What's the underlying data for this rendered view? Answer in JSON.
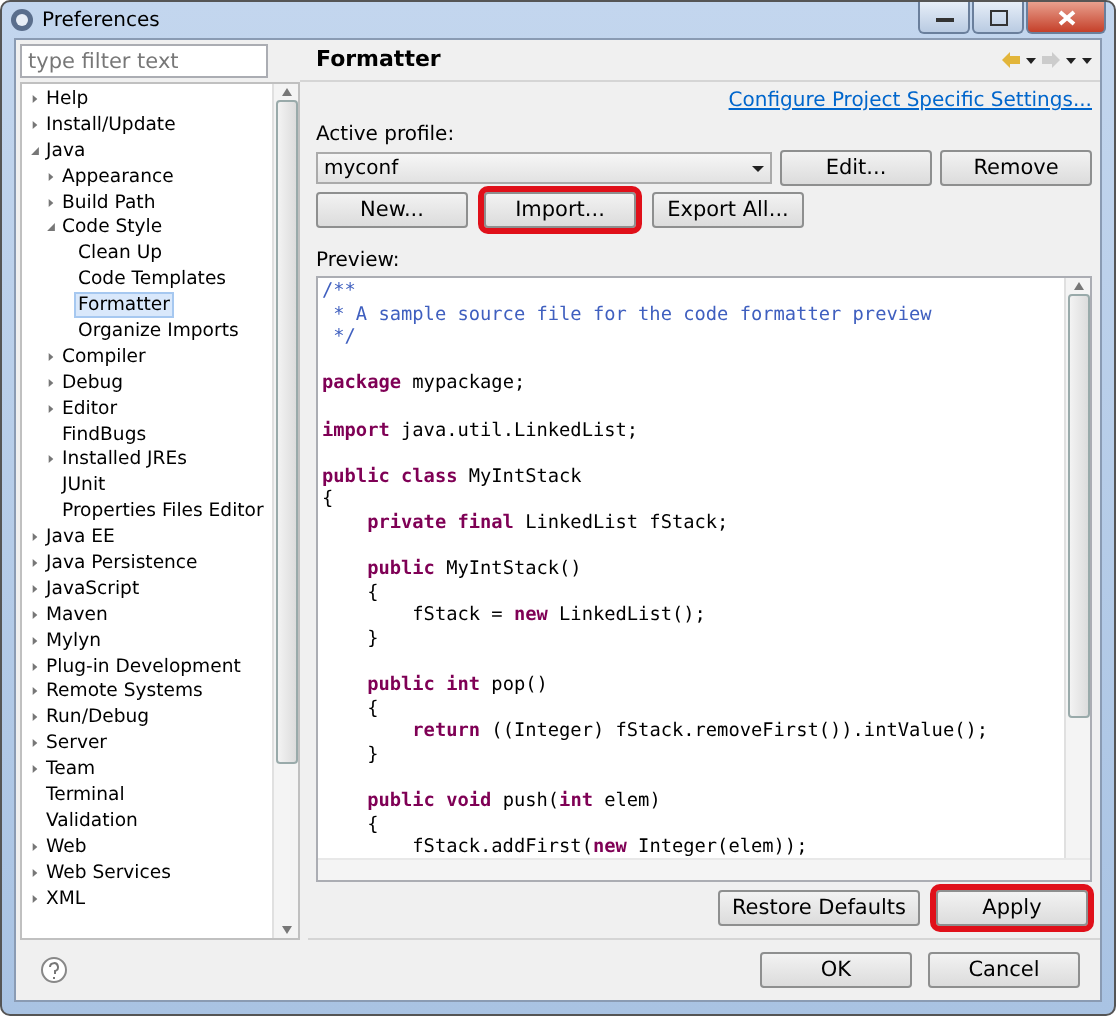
{
  "window": {
    "title": "Preferences"
  },
  "filter": {
    "placeholder": "type filter text"
  },
  "tree": [
    {
      "label": "Help",
      "expanded": false,
      "selected": false
    },
    {
      "label": "Install/Update",
      "expanded": false,
      "selected": false
    },
    {
      "label": "Java",
      "expanded": true,
      "selected": false,
      "children": [
        {
          "label": "Appearance",
          "expanded": false,
          "selected": false
        },
        {
          "label": "Build Path",
          "expanded": false,
          "selected": false
        },
        {
          "label": "Code Style",
          "expanded": true,
          "selected": false,
          "children": [
            {
              "label": "Clean Up",
              "selected": false
            },
            {
              "label": "Code Templates",
              "selected": false
            },
            {
              "label": "Formatter",
              "selected": true
            },
            {
              "label": "Organize Imports",
              "selected": false
            }
          ]
        },
        {
          "label": "Compiler",
          "expanded": false,
          "selected": false
        },
        {
          "label": "Debug",
          "expanded": false,
          "selected": false
        },
        {
          "label": "Editor",
          "expanded": false,
          "selected": false
        },
        {
          "label": "FindBugs",
          "selected": false
        },
        {
          "label": "Installed JREs",
          "expanded": false,
          "selected": false
        },
        {
          "label": "JUnit",
          "selected": false
        },
        {
          "label": "Properties Files Editor",
          "selected": false
        }
      ]
    },
    {
      "label": "Java EE",
      "expanded": false,
      "selected": false
    },
    {
      "label": "Java Persistence",
      "expanded": false,
      "selected": false
    },
    {
      "label": "JavaScript",
      "expanded": false,
      "selected": false
    },
    {
      "label": "Maven",
      "expanded": false,
      "selected": false
    },
    {
      "label": "Mylyn",
      "expanded": false,
      "selected": false
    },
    {
      "label": "Plug-in Development",
      "expanded": false,
      "selected": false
    },
    {
      "label": "Remote Systems",
      "expanded": false,
      "selected": false
    },
    {
      "label": "Run/Debug",
      "expanded": false,
      "selected": false
    },
    {
      "label": "Server",
      "expanded": false,
      "selected": false
    },
    {
      "label": "Team",
      "expanded": false,
      "selected": false
    },
    {
      "label": "Terminal",
      "selected": false
    },
    {
      "label": "Validation",
      "selected": false
    },
    {
      "label": "Web",
      "expanded": false,
      "selected": false
    },
    {
      "label": "Web Services",
      "expanded": false,
      "selected": false
    },
    {
      "label": "XML",
      "expanded": false,
      "selected": false
    }
  ],
  "page": {
    "title": "Formatter",
    "link": "Configure Project Specific Settings...",
    "profile_label": "Active profile:",
    "profile_value": "myconf",
    "profile_buttons": [
      {
        "label": "Edit...",
        "highlighted": false
      },
      {
        "label": "Remove",
        "highlighted": false
      }
    ],
    "buttons": [
      {
        "label": "New...",
        "highlighted": false
      },
      {
        "label": "Import...",
        "highlighted": true
      },
      {
        "label": "Export All...",
        "highlighted": false
      }
    ],
    "preview_label": "Preview:",
    "code": [
      {
        "tokens": [
          {
            "kind": "comment",
            "text": "/**"
          }
        ]
      },
      {
        "tokens": [
          {
            "kind": "comment",
            "text": " * A sample source file for the code formatter preview"
          }
        ]
      },
      {
        "tokens": [
          {
            "kind": "comment",
            "text": " */"
          }
        ]
      },
      {
        "kind": "blank"
      },
      {
        "tokens": [
          {
            "kind": "keyword",
            "text": "package"
          },
          {
            "kind": "plain",
            "text": " mypackage;"
          }
        ]
      },
      {
        "kind": "blank"
      },
      {
        "tokens": [
          {
            "kind": "keyword",
            "text": "import"
          },
          {
            "kind": "plain",
            "text": " java.util.LinkedList;"
          }
        ]
      },
      {
        "kind": "blank"
      },
      {
        "tokens": [
          {
            "kind": "keyword",
            "text": "public class"
          },
          {
            "kind": "plain",
            "text": " MyIntStack"
          }
        ]
      },
      {
        "tokens": [
          {
            "kind": "plain",
            "text": "{"
          }
        ]
      },
      {
        "tokens": [
          {
            "kind": "keyword",
            "text": "    private final"
          },
          {
            "kind": "plain",
            "text": " LinkedList fStack;"
          }
        ]
      },
      {
        "kind": "blank"
      },
      {
        "tokens": [
          {
            "kind": "keyword",
            "text": "    public"
          },
          {
            "kind": "plain",
            "text": " MyIntStack()"
          }
        ]
      },
      {
        "tokens": [
          {
            "kind": "plain",
            "text": "    {"
          }
        ]
      },
      {
        "tokens": [
          {
            "kind": "plain",
            "text": "        fStack = "
          },
          {
            "kind": "keyword",
            "text": "new"
          },
          {
            "kind": "plain",
            "text": " LinkedList();"
          }
        ]
      },
      {
        "tokens": [
          {
            "kind": "plain",
            "text": "    }"
          }
        ]
      },
      {
        "kind": "blank"
      },
      {
        "tokens": [
          {
            "kind": "keyword",
            "text": "    public int"
          },
          {
            "kind": "plain",
            "text": " pop()"
          }
        ]
      },
      {
        "tokens": [
          {
            "kind": "plain",
            "text": "    {"
          }
        ]
      },
      {
        "tokens": [
          {
            "kind": "keyword",
            "text": "        return"
          },
          {
            "kind": "plain",
            "text": " ((Integer) fStack.removeFirst()).intValue();"
          }
        ]
      },
      {
        "tokens": [
          {
            "kind": "plain",
            "text": "    }"
          }
        ]
      },
      {
        "kind": "blank"
      },
      {
        "tokens": [
          {
            "kind": "keyword",
            "text": "    public void"
          },
          {
            "kind": "plain",
            "text": " push("
          },
          {
            "kind": "keyword",
            "text": "int"
          },
          {
            "kind": "plain",
            "text": " elem)"
          }
        ]
      },
      {
        "tokens": [
          {
            "kind": "plain",
            "text": "    {"
          }
        ]
      },
      {
        "tokens": [
          {
            "kind": "plain",
            "text": "        fStack.addFirst("
          },
          {
            "kind": "keyword",
            "text": "new"
          },
          {
            "kind": "plain",
            "text": " Integer(elem));"
          }
        ]
      }
    ],
    "bottom_buttons": [
      {
        "label": "Restore Defaults",
        "highlighted": false
      },
      {
        "label": "Apply",
        "highlighted": true
      }
    ]
  },
  "dialog_buttons": [
    {
      "label": "OK",
      "highlighted": false
    },
    {
      "label": "Cancel",
      "highlighted": false
    }
  ]
}
